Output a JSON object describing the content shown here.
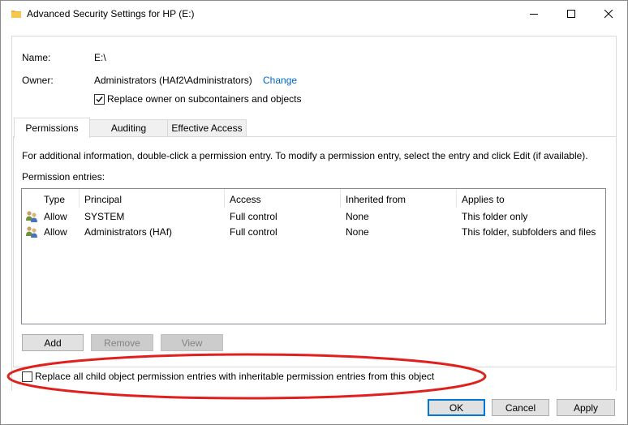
{
  "window": {
    "title": "Advanced Security Settings for HP (E:)",
    "minimize_icon": "minimize-icon",
    "maximize_icon": "maximize-icon",
    "close_icon": "close-icon"
  },
  "header": {
    "name_label": "Name:",
    "name_value": "E:\\",
    "owner_label": "Owner:",
    "owner_value": "Administrators (HAf2\\Administrators)",
    "change_link": "Change",
    "replace_owner_label": "Replace owner on subcontainers and objects",
    "replace_owner_checked": true
  },
  "tabs": [
    {
      "label": "Permissions",
      "active": true
    },
    {
      "label": "Auditing",
      "active": false
    },
    {
      "label": "Effective Access",
      "active": false
    }
  ],
  "permissions": {
    "info_text": "For additional information, double-click a permission entry. To modify a permission entry, select the entry and click Edit (if available).",
    "entries_label": "Permission entries:",
    "columns": [
      "Type",
      "Principal",
      "Access",
      "Inherited from",
      "Applies to"
    ],
    "rows": [
      {
        "type": "Allow",
        "principal": "SYSTEM",
        "access": "Full control",
        "inherited_from": "None",
        "applies_to": "This folder only"
      },
      {
        "type": "Allow",
        "principal": "Administrators (HAf)",
        "access": "Full control",
        "inherited_from": "None",
        "applies_to": "This folder, subfolders and files"
      }
    ],
    "buttons": {
      "add": "Add",
      "remove": "Remove",
      "view": "View"
    }
  },
  "replace_child_label": "Replace all child object permission entries with inheritable permission entries from this object",
  "replace_child_checked": false,
  "footer": {
    "ok": "OK",
    "cancel": "Cancel",
    "apply": "Apply"
  },
  "colors": {
    "link": "#0066cc",
    "annotation_ellipse": "#e0201c",
    "default_button_border": "#0078d7"
  }
}
